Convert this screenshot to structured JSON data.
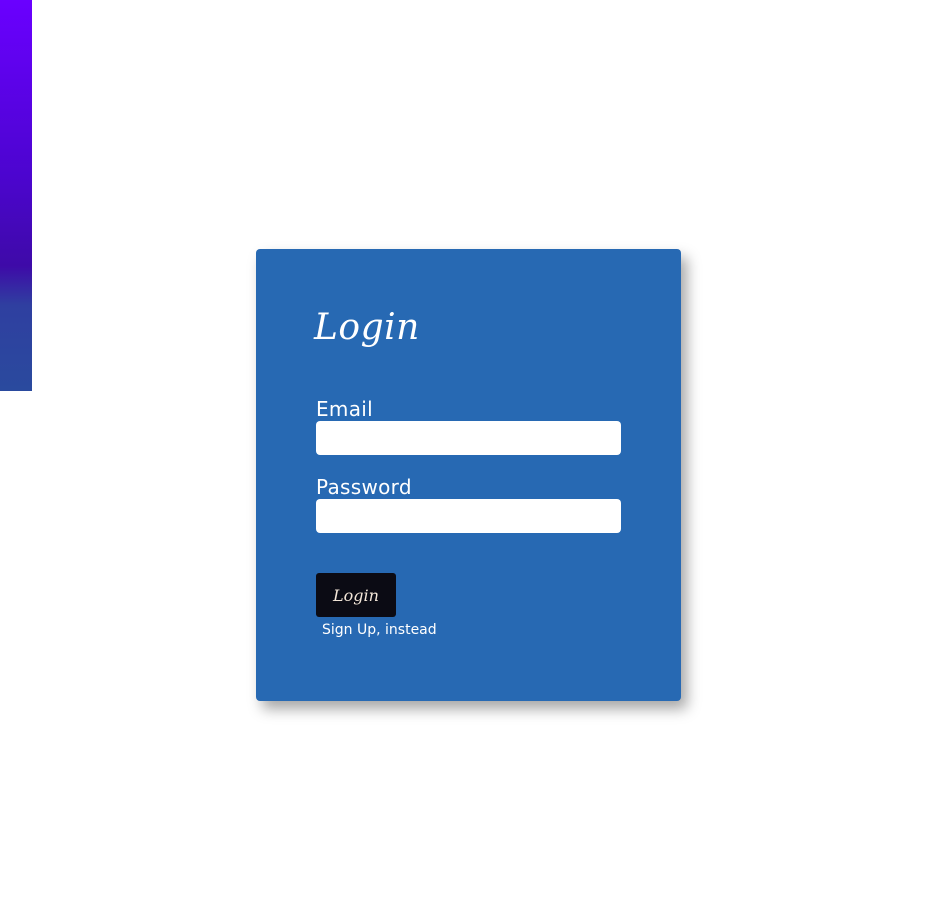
{
  "form": {
    "title": "Login",
    "email": {
      "label": "Email",
      "value": "",
      "placeholder": ""
    },
    "password": {
      "label": "Password",
      "value": "",
      "placeholder": ""
    },
    "submit_label": "Login",
    "signup_link": "Sign Up, instead"
  },
  "colors": {
    "card_background": "#2769b3",
    "button_background": "#0b0b14",
    "side_strip_top": "#6a00ff",
    "side_strip_bottom": "#2a4a9e"
  }
}
